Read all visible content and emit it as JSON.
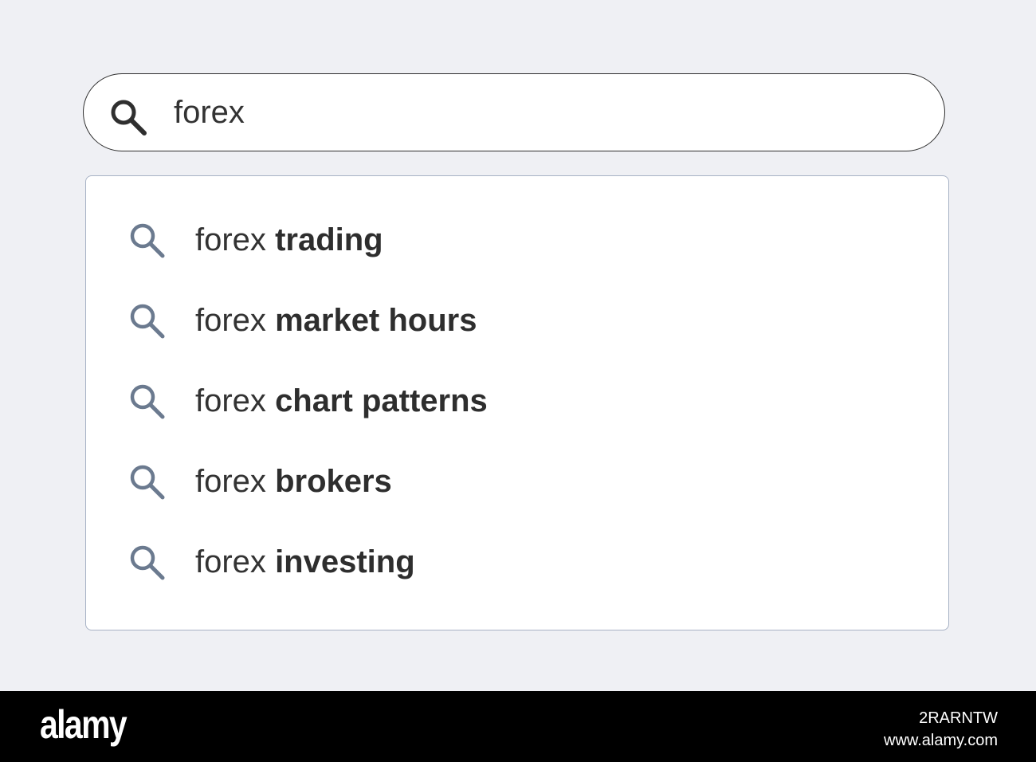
{
  "search": {
    "query": "forex",
    "icon": "search-icon",
    "border_color": "#2f2f2f"
  },
  "suggestions": [
    {
      "prefix": "forex",
      "completion": "trading"
    },
    {
      "prefix": "forex",
      "completion": "market hours"
    },
    {
      "prefix": "forex",
      "completion": "chart patterns"
    },
    {
      "prefix": "forex",
      "completion": "brokers"
    },
    {
      "prefix": "forex",
      "completion": "investing"
    }
  ],
  "suggestion_icon": "search-icon",
  "colors": {
    "background": "#eff0f4",
    "text": "#333333",
    "suggestion_icon": "#6b7a8f",
    "panel_border": "#a7b2c5"
  },
  "footer": {
    "logo": "alamy",
    "image_id": "2RARNTW",
    "site": "www.alamy.com"
  }
}
